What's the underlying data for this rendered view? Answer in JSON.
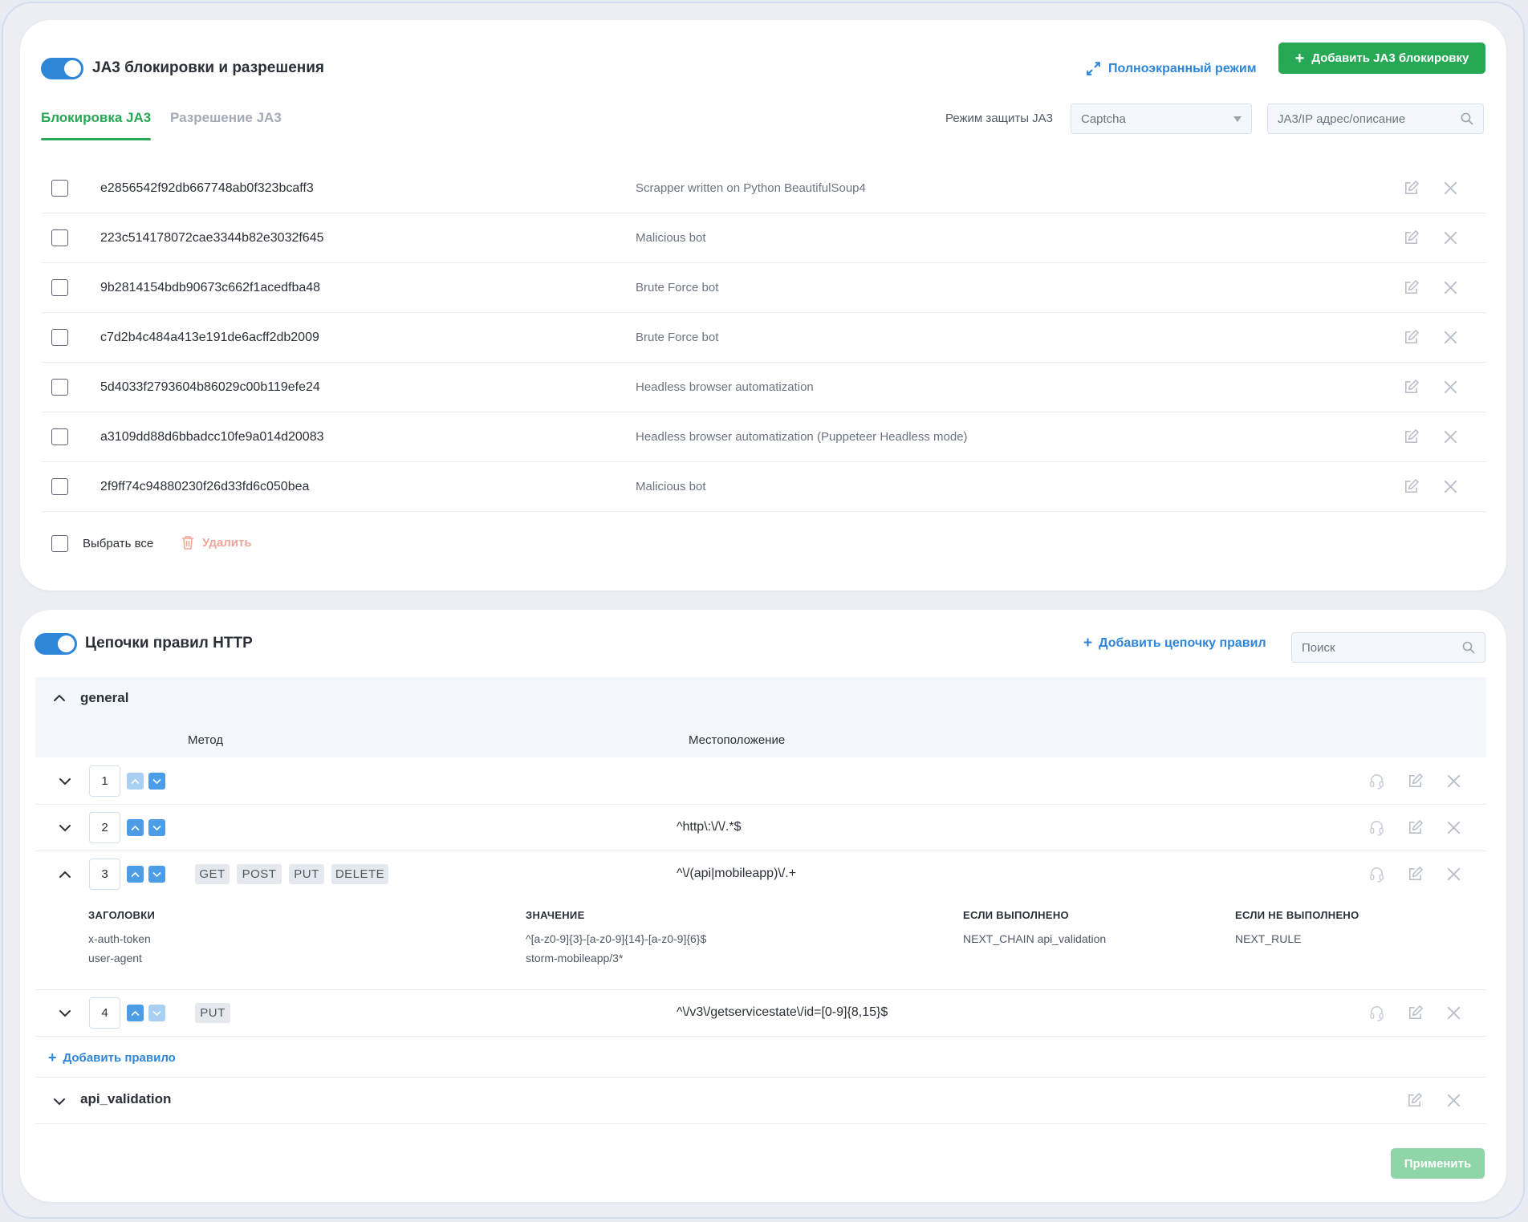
{
  "ja3": {
    "title": "JA3 блокировки и разрешения",
    "fullscreen_label": "Полноэкранный режим",
    "add_button_label": "Добавить JA3 блокировку",
    "tabs": [
      {
        "label": "Блокировка JA3",
        "active": true
      },
      {
        "label": "Разрешение JA3",
        "active": false
      }
    ],
    "protection_mode_label": "Режим защиты JA3",
    "protection_mode_value": "Captcha",
    "search_placeholder": "JA3/IP адрес/описание",
    "items": [
      {
        "hash": "e2856542f92db667748ab0f323bcaff3",
        "description": "Scrapper written on Python BeautifulSoup4"
      },
      {
        "hash": "223c514178072cae3344b82e3032f645",
        "description": "Malicious bot"
      },
      {
        "hash": "9b2814154bdb90673c662f1acedfba48",
        "description": "Brute Force bot"
      },
      {
        "hash": "c7d2b4c484a413e191de6acff2db2009",
        "description": "Brute Force bot"
      },
      {
        "hash": "5d4033f2793604b86029c00b119efe24",
        "description": "Headless browser automatization"
      },
      {
        "hash": "a3109dd88d6bbadcc10fe9a014d20083",
        "description": "Headless browser automatization (Puppeteer Headless mode)"
      },
      {
        "hash": "2f9ff74c94880230f26d33fd6c050bea",
        "description": "Malicious bot"
      }
    ],
    "select_all_label": "Выбрать все",
    "delete_label": "Удалить"
  },
  "http_chains": {
    "title": "Цепочки правил HTTP",
    "add_chain_label": "Добавить цепочку правил",
    "search_placeholder": "Поиск",
    "chains": [
      {
        "name": "general",
        "expanded": true
      },
      {
        "name": "api_validation",
        "expanded": false
      }
    ],
    "columns": {
      "method": "Метод",
      "location": "Местоположение"
    },
    "rules": [
      {
        "num": "1",
        "methods": [],
        "location": ""
      },
      {
        "num": "2",
        "methods": [],
        "location": "^http\\:\\/\\/.*$"
      },
      {
        "num": "3",
        "methods": [
          "GET",
          "POST",
          "PUT",
          "DELETE"
        ],
        "location": "^\\/(api|mobileapp)\\/.+"
      },
      {
        "num": "4",
        "methods": [
          "PUT"
        ],
        "location": "^\\/v3\\/getservicestate\\/id=[0-9]{8,15}$"
      }
    ],
    "rule3_details": {
      "headers_title": "ЗАГОЛОВКИ",
      "value_title": "ЗНАЧЕНИЕ",
      "if_done_title": "ЕСЛИ ВЫПОЛНЕНО",
      "if_not_done_title": "ЕСЛИ НЕ ВЫПОЛНЕНО",
      "headers": [
        "x-auth-token",
        "user-agent"
      ],
      "values": [
        "^[a-z0-9]{3}-[a-z0-9]{14}-[a-z0-9]{6}$",
        "storm-mobileapp/3*"
      ],
      "if_done": "NEXT_CHAIN api_validation",
      "if_not_done": "NEXT_RULE"
    },
    "add_rule_label": "Добавить правило",
    "apply_label": "Применить"
  },
  "colors": {
    "accent_green": "#27a855",
    "accent_blue": "#2e86d9",
    "danger_light": "#f1a59a",
    "apply_disabled": "#8fd5a8"
  }
}
